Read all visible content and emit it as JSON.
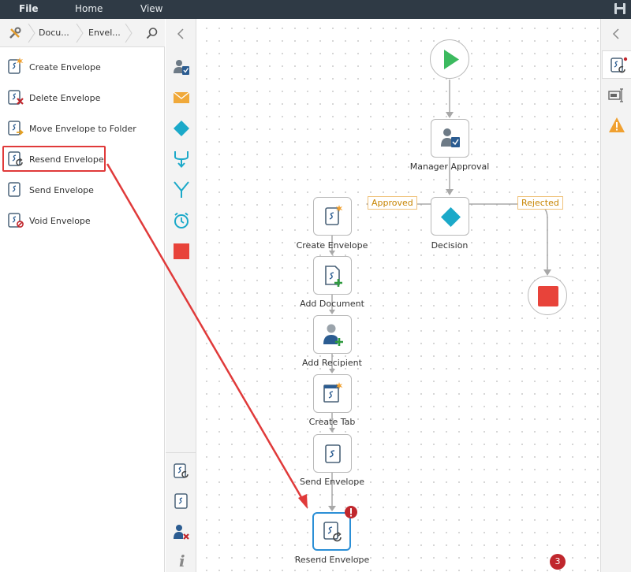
{
  "menu": {
    "file": "File",
    "home": "Home",
    "view": "View"
  },
  "breadcrumb": {
    "crumb1": "Docu...",
    "crumb2": "Envel..."
  },
  "actions": [
    {
      "label": "Create Envelope"
    },
    {
      "label": "Delete Envelope"
    },
    {
      "label": "Move Envelope to Folder"
    },
    {
      "label": "Resend Envelope"
    },
    {
      "label": "Send Envelope"
    },
    {
      "label": "Void Envelope"
    }
  ],
  "toolbox": [
    "person-task-icon",
    "email-icon",
    "decision-diamond-icon",
    "merge-icon",
    "split-icon",
    "timer-icon",
    "stop-icon",
    "envelope-resend-icon",
    "envelope-icon",
    "remove-user-icon",
    "info-icon"
  ],
  "workflow": {
    "nodes": {
      "manager_approval": "Manager Approval",
      "decision": "Decision",
      "create_envelope": "Create Envelope",
      "add_document": "Add Document",
      "add_recipient": "Add Recipient",
      "create_tab": "Create Tab",
      "send_envelope": "Send Envelope",
      "resend_envelope": "Resend Envelope"
    },
    "branches": {
      "approved": "Approved",
      "rejected": "Rejected"
    }
  },
  "status": {
    "issue_count": "3"
  },
  "colors": {
    "accent_blue": "#2b8fd6",
    "start_green": "#3cba5f",
    "stop_red": "#e8433a",
    "decision_cyan": "#1ba9c9",
    "annotation_red": "#e03a3a"
  }
}
